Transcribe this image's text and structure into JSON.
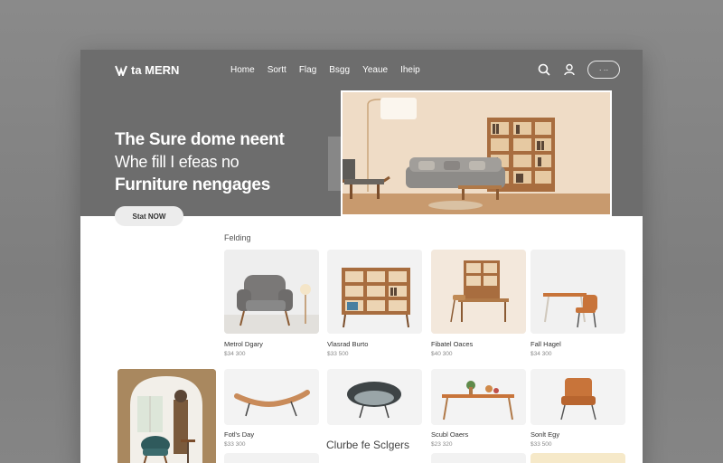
{
  "brand": {
    "name": "ta MERN"
  },
  "nav": [
    "Home",
    "Sortt",
    "Flag",
    "Bsgg",
    "Yeaue",
    "Iheip"
  ],
  "header": {
    "cart_label": "· ··"
  },
  "hero": {
    "line1": "The Sure dome neent",
    "line2": "Whe fill I efeas no",
    "line3": "Furniture nengages",
    "cta": "Stat NOW"
  },
  "section": {
    "label": "Felding"
  },
  "products": [
    {
      "name": "Metrol Dgary",
      "price": "$34 300"
    },
    {
      "name": "Vlasrad Burto",
      "price": "$33 500"
    },
    {
      "name": "Fibatel Oaces",
      "price": "$40 300"
    },
    {
      "name": "Fall Hagel",
      "price": "$34 300"
    }
  ],
  "products2": [
    {
      "name": "Fotl's Day",
      "price": "$33 300"
    },
    {
      "name": "",
      "price": ""
    },
    {
      "name": "Scubl Oaers",
      "price": "$23 320"
    },
    {
      "name": "Sonlt Egy",
      "price": "$33 500"
    }
  ],
  "section2": {
    "title": "Clurbe fe Sclgers"
  },
  "colors": {
    "hero_bg": "#6d6d6d",
    "page_bg": "#ffffff",
    "accent": "#c8743a"
  }
}
